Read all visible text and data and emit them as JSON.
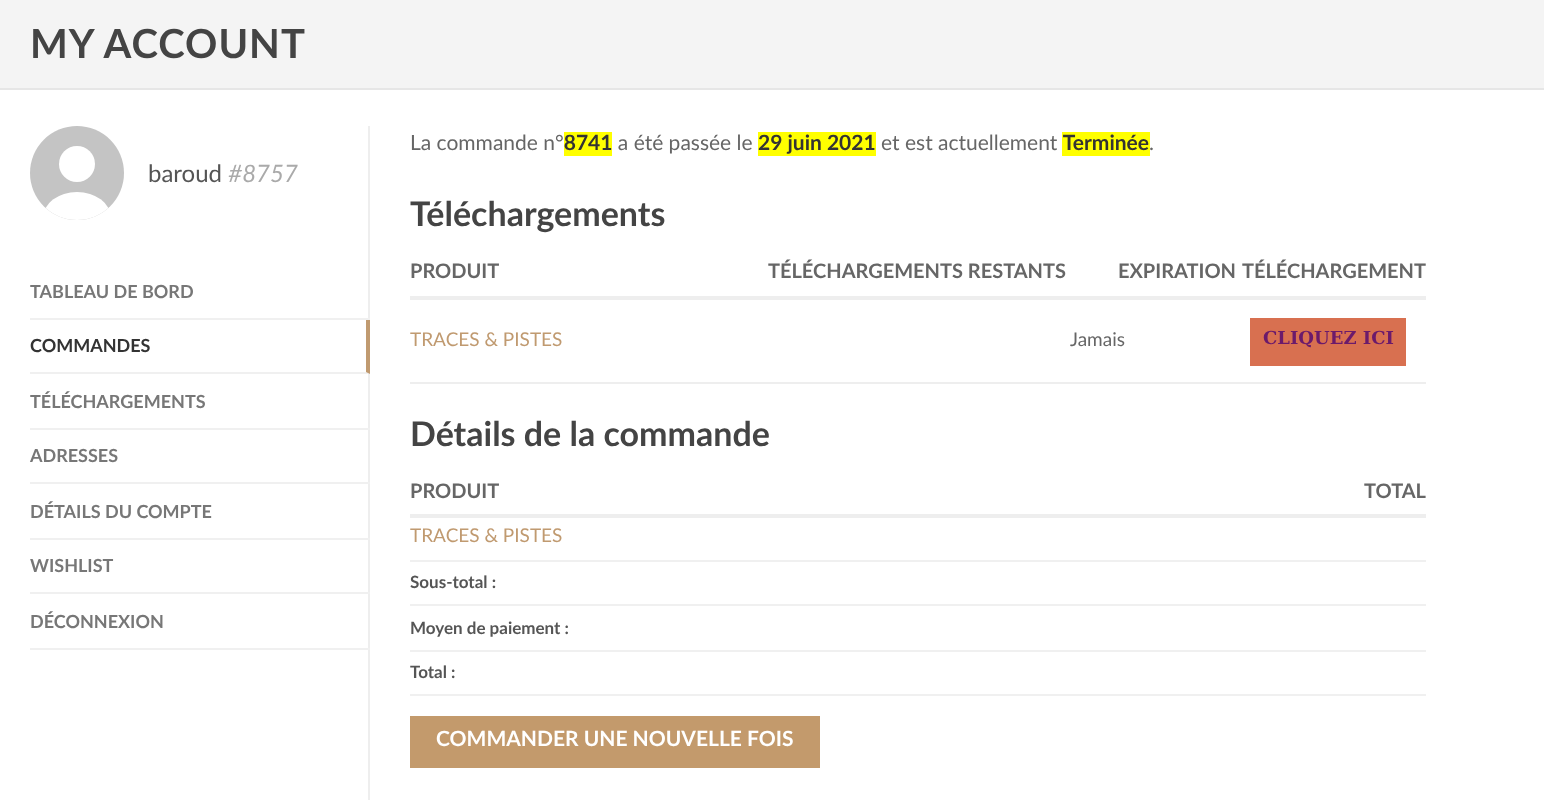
{
  "header": {
    "title": "MY ACCOUNT"
  },
  "user": {
    "name": "baroud",
    "id": "#8757"
  },
  "sidebar": {
    "items": [
      {
        "label": "TABLEAU DE BORD",
        "selected": false
      },
      {
        "label": "COMMANDES",
        "selected": true
      },
      {
        "label": "TÉLÉCHARGEMENTS",
        "selected": false
      },
      {
        "label": "ADRESSES",
        "selected": false
      },
      {
        "label": "DÉTAILS DU COMPTE",
        "selected": false
      },
      {
        "label": "WISHLIST",
        "selected": false
      },
      {
        "label": "DÉCONNEXION",
        "selected": false
      }
    ]
  },
  "status": [
    {
      "text": "La commande n°",
      "highlighted": false
    },
    {
      "text": "8741",
      "highlighted": true
    },
    {
      "text": " a été passée le ",
      "highlighted": false
    },
    {
      "text": "29 juin 2021",
      "highlighted": true
    },
    {
      "text": " et est actuellement ",
      "highlighted": false
    },
    {
      "text": "Terminée",
      "highlighted": true
    },
    {
      "text": ".",
      "highlighted": false
    }
  ],
  "downloads": {
    "title": "Téléchargements",
    "columns": [
      "PRODUIT",
      "TÉLÉCHARGEMENTS RESTANTS",
      "EXPIRATION",
      "TÉLÉCHARGEMENT"
    ],
    "rows": [
      {
        "product": "TRACES & PISTES",
        "expiration": "Jamais",
        "button": "CLIQUEZ ICI"
      }
    ]
  },
  "details": {
    "title": "Détails de la commande",
    "columns": [
      "PRODUIT",
      "TOTAL"
    ],
    "product": "TRACES & PISTES",
    "summary": [
      "Sous-total :",
      "Moyen de paiement :",
      "Total :"
    ]
  },
  "reorder_button": "COMMANDER UNE NOUVELLE FOIS"
}
